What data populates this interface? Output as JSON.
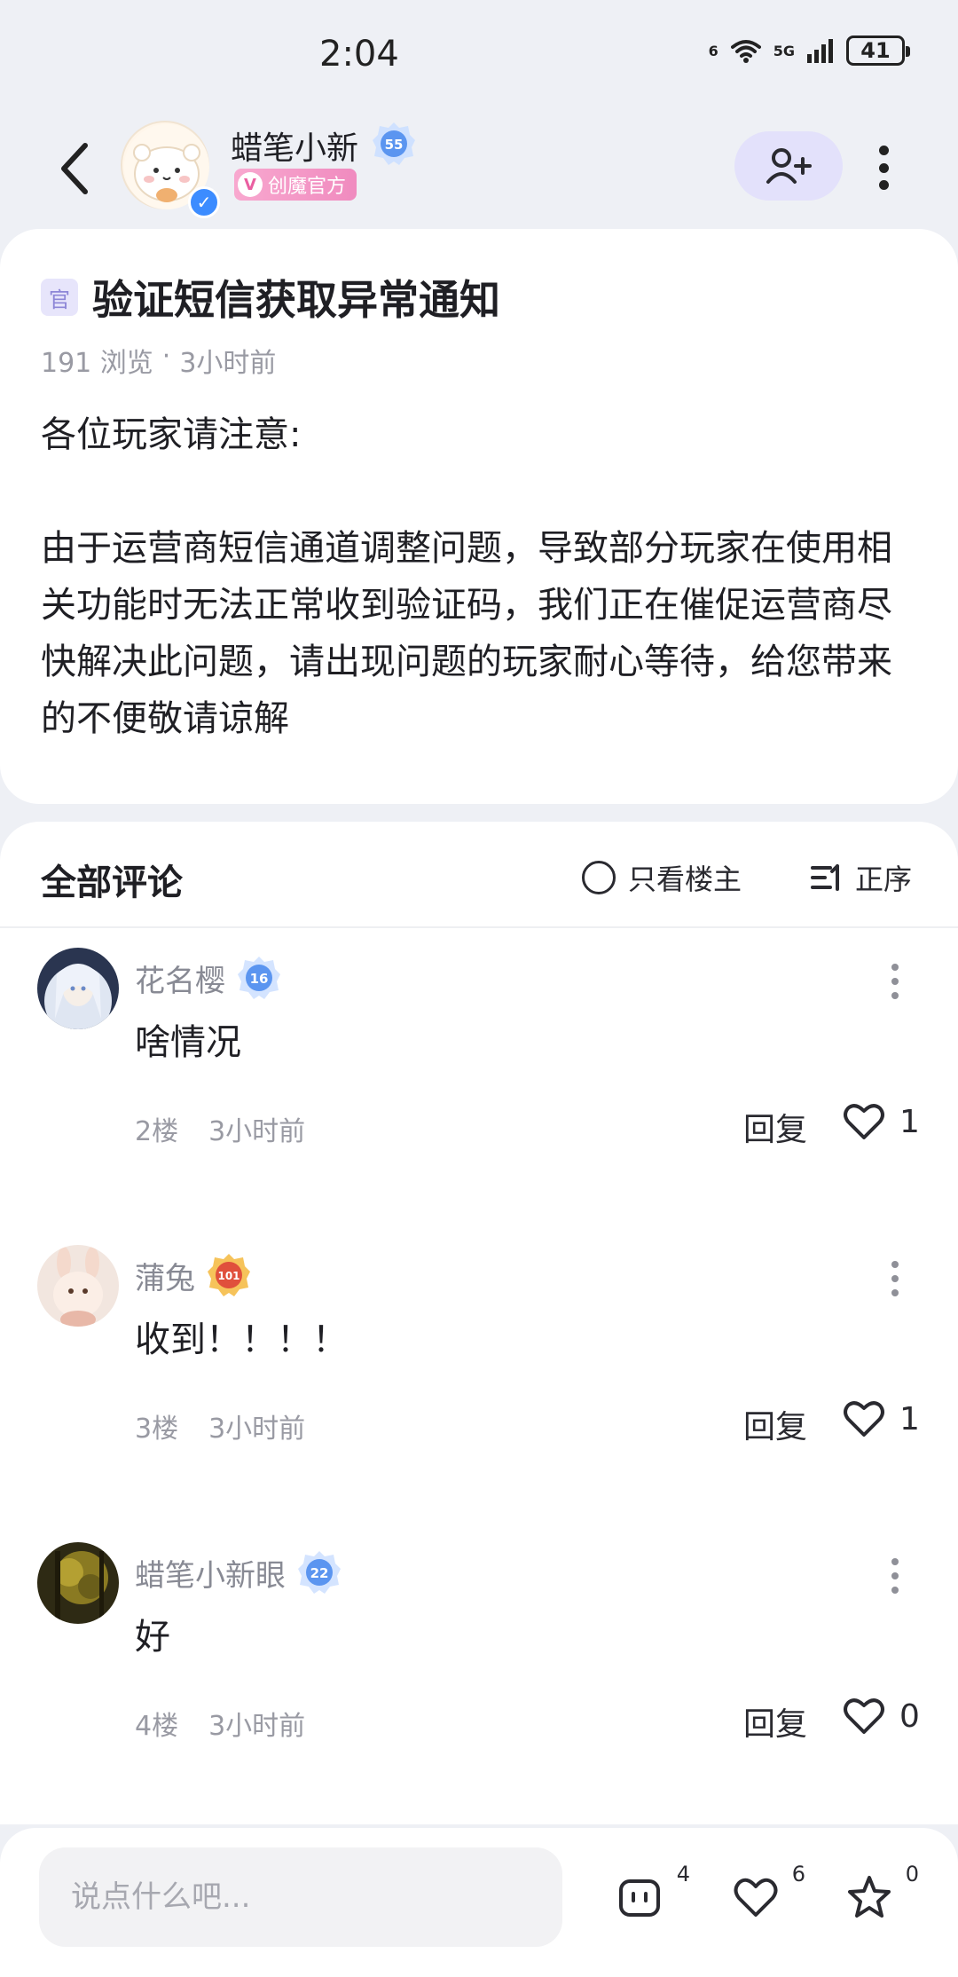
{
  "status_bar": {
    "time": "2:04",
    "network_1": "6",
    "network_2": "5G",
    "battery": "41"
  },
  "header": {
    "author_name": "蜡笔小新",
    "author_level": "55",
    "official_tag": "创魔官方",
    "official_tag_icon": "V"
  },
  "post": {
    "official_icon_text": "官",
    "title": "验证短信获取异常通知",
    "views": "191 浏览",
    "separator": "·",
    "time": "3小时前",
    "paragraphs": [
      "各位玩家请注意:",
      "由于运营商短信通道调整问题，导致部分玩家在使用相关功能时无法正常收到验证码，我们正在催促运营商尽快解决此问题，请出现问题的玩家耐心等待，给您带来的不便敬请谅解"
    ]
  },
  "comments_section": {
    "title": "全部评论",
    "only_op_label": "只看楼主",
    "sort_label": "正序",
    "reply_label": "回复",
    "items": [
      {
        "name": "花名樱",
        "level": "16",
        "text": "啥情况",
        "floor": "2楼",
        "time": "3小时前",
        "likes": "1",
        "level_color": "#6aa2f5"
      },
      {
        "name": "蒲兔",
        "level": "101",
        "text": "收到！！！！",
        "floor": "3楼",
        "time": "3小时前",
        "likes": "1",
        "level_color": "#f29a3a"
      },
      {
        "name": "蜡笔小新眼",
        "level": "22",
        "text": "好",
        "floor": "4楼",
        "time": "3小时前",
        "likes": "0",
        "level_color": "#6aa2f5"
      }
    ]
  },
  "bottom_bar": {
    "input_placeholder": "说点什么吧...",
    "comment_count": "4",
    "like_count": "6",
    "favorite_count": "0"
  },
  "colors": {
    "accent_purple": "#e3e1fb",
    "official_pink": "#f08bbf",
    "background": "#eef0f5"
  }
}
